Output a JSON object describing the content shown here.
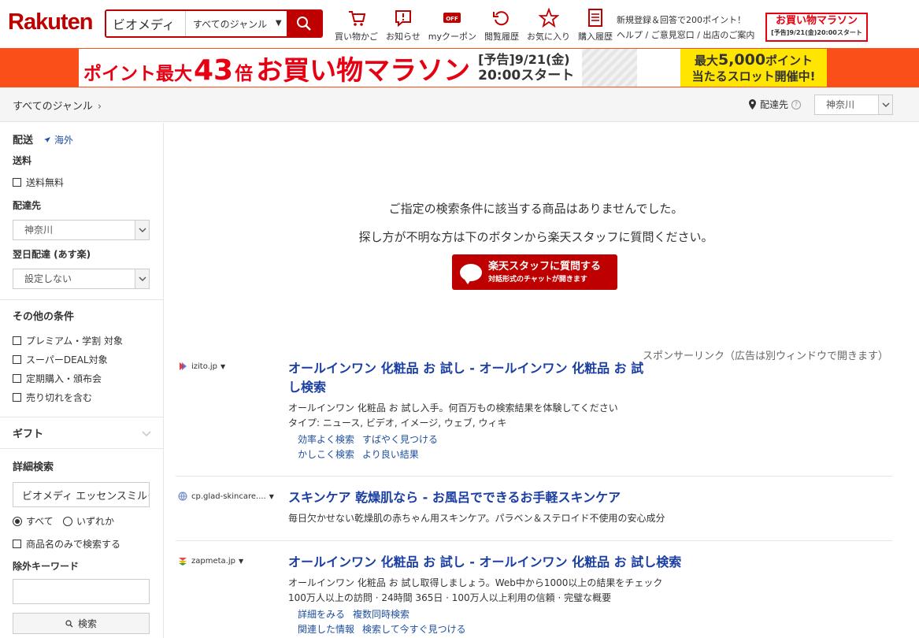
{
  "header": {
    "logo": "Rakuten",
    "search_value": "ビオメディ エッセンスミルク",
    "genre": "すべてのジャンル",
    "nav": [
      {
        "label": "買い物かご",
        "icon": "cart-icon"
      },
      {
        "label": "お知らせ",
        "icon": "notice-icon"
      },
      {
        "label": "myクーポン",
        "icon": "coupon-icon"
      },
      {
        "label": "閲覧履歴",
        "icon": "history-icon"
      },
      {
        "label": "お気に入り",
        "icon": "star-icon"
      },
      {
        "label": "購入履歴",
        "icon": "receipt-icon"
      }
    ],
    "signup_text": "新規登録＆回答で200ポイント！",
    "links_text": "ヘルプ / ご意見窓口 / 出店のご案内",
    "marathon_title": "お買い物マラソン",
    "marathon_sub": "[予告]9/21(金)20:00スタート"
  },
  "banner": {
    "prefix": "ポイント最大",
    "number": "43",
    "suffix": "倍",
    "title": "お買い物マラソン",
    "notice": "[予告]9/21(金)",
    "start": "20:00スタート",
    "slot_line1_a": "最大",
    "slot_line1_b": "5,000",
    "slot_line1_c": "ポイント",
    "slot_line2": "当たるスロット開催中!"
  },
  "crumb": {
    "genre": "すべてのジャンル",
    "chevron": "›",
    "deliver_label": "配達先",
    "deliver_value": "神奈川"
  },
  "sidebar": {
    "shipping_title": "配送",
    "overseas": "海外",
    "fee_label": "送料",
    "free_shipping": "送料無料",
    "dest_label": "配達先",
    "dest_value": "神奈川",
    "nextday_label": "翌日配達 (あす楽)",
    "nextday_value": "設定しない",
    "other_title": "その他の条件",
    "other_items": [
      "プレミアム・学割 対象",
      "スーパーDEAL対象",
      "定期購入・頒布会",
      "売り切れを含む"
    ],
    "gift_title": "ギフト",
    "detail_title": "詳細検索",
    "detail_value": "ビオメディ エッセンスミルク",
    "radio_all": "すべて",
    "radio_any": "いずれか",
    "name_only": "商品名のみで検索する",
    "exclude_label": "除外キーワード",
    "search_btn": "検索"
  },
  "main": {
    "no_result_1": "ご指定の検索条件に該当する商品はありませんでした。",
    "no_result_2": "探し方が不明な方は下のボタンから楽天スタッフに質問ください。",
    "ask_line1": "楽天スタッフに質問する",
    "ask_line2": "対話形式のチャットが開きます",
    "sponsor_note": "スポンサーリンク（広告は別ウィンドウで開きます）",
    "ads": [
      {
        "source": "izito.jp",
        "title_1": "オールインワン 化粧品 お 試し - オールインワン 化粧品 お 試",
        "title_2": "し検索",
        "desc_1": "オールインワン 化粧品 お 試し入手。何百万もの検索結果を体験してください",
        "desc_2": "タイプ: ニュース, ビデオ, イメージ, ウェブ, ウィキ",
        "links_1": [
          "効率よく検索",
          "すばやく見つける"
        ],
        "links_2": [
          "かしこく検索",
          "より良い結果"
        ]
      },
      {
        "source": "cp.glad-skincare....",
        "title_1": "スキンケア 乾燥肌なら - お風呂でできるお手軽スキンケア",
        "desc_1": "毎日欠かせない乾燥肌の赤ちゃん用スキンケア。パラベン＆ステロイド不使用の安心成分"
      },
      {
        "source": "zapmeta.jp",
        "title_1": "オールインワン 化粧品 お 試し - オールインワン 化粧品 お 試し検索",
        "desc_1": "オールインワン 化粧品 お 試し取得しましょう。Web中から1000以上の結果をチェック",
        "desc_2": "100万人以上の訪問 · 24時間 365日 · 100万人以上利用の信頼 · 完璧な概要",
        "links_1": [
          "詳細をみる",
          "複数同時検索"
        ],
        "links_2": [
          "関連した情報",
          "検索して今すぐ見つける"
        ]
      }
    ]
  },
  "colors": {
    "brand": "#bf0000",
    "link": "#1a3ea1",
    "banner": "#fb4f1a",
    "slot": "#ffe500"
  }
}
